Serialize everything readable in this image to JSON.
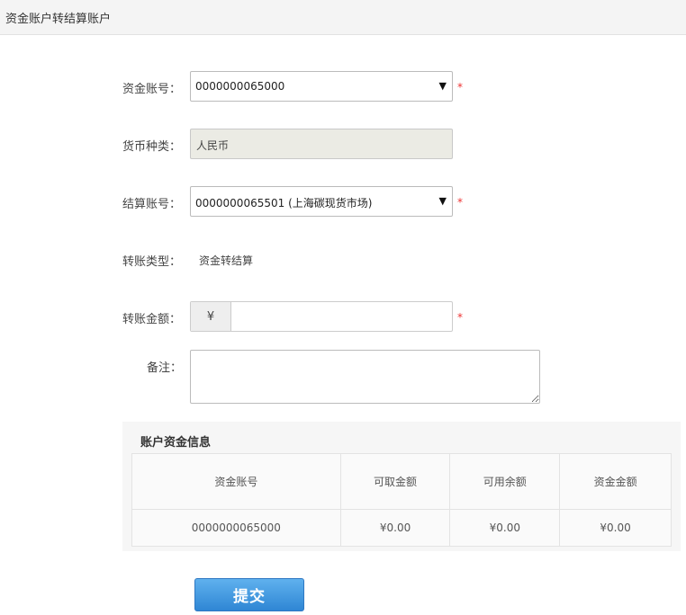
{
  "header": {
    "title": "资金账户转结算账户"
  },
  "form": {
    "fund_account": {
      "label": "资金账号：",
      "value": "0000000065000",
      "required_mark": "*"
    },
    "currency": {
      "label": "货币种类：",
      "value": "人民币"
    },
    "settlement_account": {
      "label": "结算账号：",
      "value": "0000000065501 (上海碳现货市场)",
      "required_mark": "*"
    },
    "transfer_type": {
      "label": "转账类型：",
      "value": "资金转结算"
    },
    "amount": {
      "label": "转账金额：",
      "currency_symbol": "¥",
      "value": "",
      "required_mark": "*"
    },
    "remark": {
      "label": "备注：",
      "value": ""
    }
  },
  "info_panel": {
    "title": "账户资金信息",
    "columns": [
      "资金账号",
      "可取金额",
      "可用余额",
      "资金金额"
    ],
    "rows": [
      [
        "0000000065000",
        "¥0.00",
        "¥0.00",
        "¥0.00"
      ]
    ]
  },
  "submit": {
    "label": "提交"
  },
  "icons": {
    "dropdown": "chevron-down-icon"
  },
  "colors": {
    "required": "#e33333",
    "button": "#2f86d4",
    "readonly_bg": "#ebebe4"
  }
}
